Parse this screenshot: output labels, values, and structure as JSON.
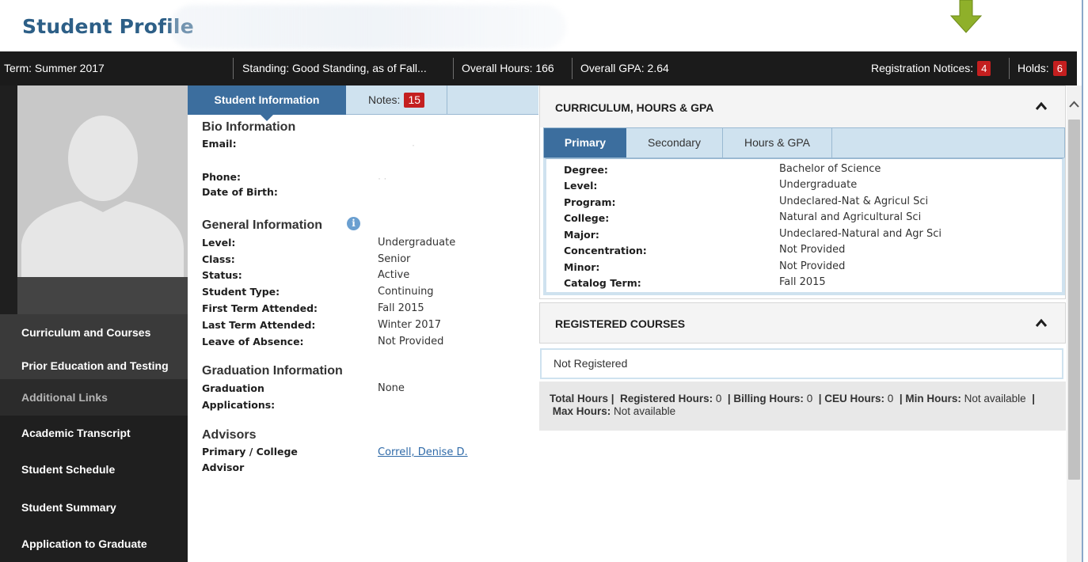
{
  "header": {
    "title": "Student Profile"
  },
  "statusbar": {
    "term": "Term: Summer 2017",
    "standing": "Standing: Good Standing, as of Fall...",
    "overall_hours": "Overall Hours: 166",
    "overall_gpa": "Overall GPA: 2.64",
    "registration_notices_label": "Registration Notices:",
    "registration_notices_count": "4",
    "holds_label": "Holds:",
    "holds_count": "6"
  },
  "sidebar": {
    "items": [
      {
        "label": "Curriculum and Courses"
      },
      {
        "label": "Prior Education and Testing"
      },
      {
        "label": "Additional Links"
      },
      {
        "label": "Academic Transcript"
      },
      {
        "label": "Student Schedule"
      },
      {
        "label": "Student Summary"
      },
      {
        "label": "Application to Graduate"
      }
    ]
  },
  "student_info": {
    "tabs": {
      "info": "Student Information",
      "notes_label": "Notes:",
      "notes_count": "15"
    },
    "bio": {
      "heading": "Bio Information",
      "email_label": "Email:",
      "phone_label": "Phone:",
      "dob_label": "Date of Birth:"
    },
    "general": {
      "heading": "General Information",
      "rows": [
        {
          "label": "Level:",
          "value": "Undergraduate"
        },
        {
          "label": "Class:",
          "value": "Senior"
        },
        {
          "label": "Status:",
          "value": "Active"
        },
        {
          "label": "Student Type:",
          "value": "Continuing"
        },
        {
          "label": "First Term Attended:",
          "value": "Fall 2015"
        },
        {
          "label": "Last Term Attended:",
          "value": "Winter 2017"
        },
        {
          "label": "Leave of Absence:",
          "value": "Not Provided"
        }
      ]
    },
    "graduation": {
      "heading": "Graduation Information",
      "label_line1": "Graduation",
      "label_line2": "Applications:",
      "value": "None"
    },
    "advisors": {
      "heading": "Advisors",
      "label_line1": "Primary / College",
      "label_line2": "Advisor",
      "value": "Correll, Denise D."
    }
  },
  "curriculum": {
    "title": "CURRICULUM, HOURS & GPA",
    "tabs": [
      "Primary",
      "Secondary",
      "Hours & GPA"
    ],
    "rows": [
      {
        "label": "Degree:",
        "value": "Bachelor of Science"
      },
      {
        "label": "Level:",
        "value": "Undergraduate"
      },
      {
        "label": "Program:",
        "value": "Undeclared-Nat & Agricul Sci"
      },
      {
        "label": "College:",
        "value": "Natural and Agricultural Sci"
      },
      {
        "label": "Major:",
        "value": "Undeclared-Natural and Agr Sci"
      },
      {
        "label": "Concentration:",
        "value": "Not Provided"
      },
      {
        "label": "Minor:",
        "value": "Not Provided"
      },
      {
        "label": "Catalog Term:",
        "value": "Fall 2015"
      }
    ]
  },
  "registered": {
    "title": "REGISTERED COURSES",
    "status": "Not Registered",
    "total_hours_label": "Total Hours |",
    "registered_hours_label": "Registered Hours:",
    "registered_hours_value": "0",
    "billing_hours_label": "Billing Hours:",
    "billing_hours_value": "0",
    "ceu_hours_label": "CEU Hours:",
    "ceu_hours_value": "0",
    "min_hours_label": "Min Hours:",
    "min_hours_value": "Not available",
    "max_hours_label": "Max Hours:",
    "max_hours_value": "Not available"
  },
  "colors": {
    "title_blue": "#2d5f87",
    "statusbar_bg": "#1b1b1b",
    "badge_red": "#c41f1f",
    "active_tab": "#3c6e9e",
    "tab_strip": "#cfe2ef",
    "arrow_green": "#8fb02a"
  }
}
